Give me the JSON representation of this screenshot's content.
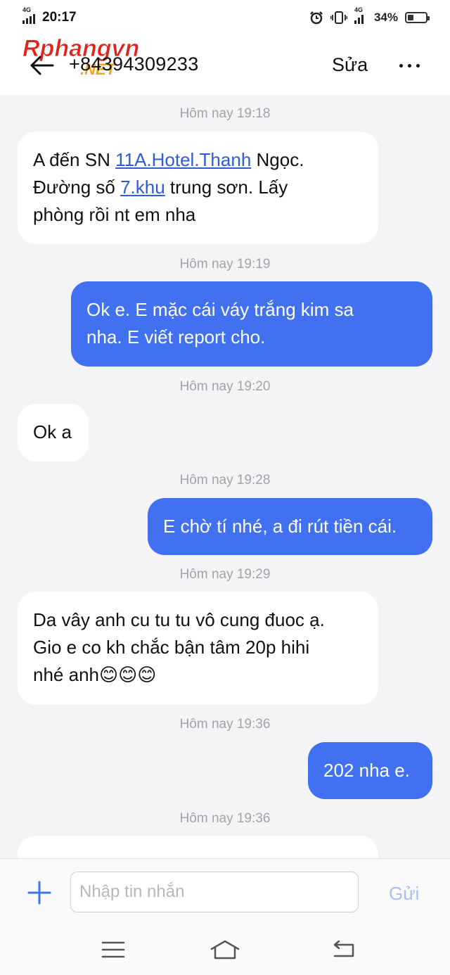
{
  "status_bar": {
    "network_left": "4G",
    "time": "20:17",
    "network_right": "4G",
    "battery_text": "34%",
    "battery_level": 0.34,
    "icons": [
      "signal-icon",
      "alarm-icon",
      "vibrate-icon",
      "battery-icon"
    ]
  },
  "header": {
    "back_icon": "back-arrow-icon",
    "contact": "+84394309233",
    "edit_label": "Sửa",
    "more_icon": "more-dots-icon",
    "watermark": {
      "main": "Rphangvn",
      "sub": ".NET"
    }
  },
  "timestamps": [
    "Hôm nay 19:18",
    "Hôm nay 19:19",
    "Hôm nay 19:20",
    "Hôm nay 19:28",
    "Hôm nay 19:29",
    "Hôm nay 19:36",
    "Hôm nay 19:36"
  ],
  "messages": {
    "m1": {
      "direction": "incoming",
      "l1_a": "A đến SN ",
      "l1_link": "11A.Hotel.Thanh",
      "l1_b": " Ngọc.",
      "l2_a": "Đường số ",
      "l2_link": "7.khu",
      "l2_b": " trung sơn. Lấy",
      "l3": "phòng rồi nt em nha"
    },
    "m2": {
      "direction": "outgoing",
      "l1": "Ok e. E mặc cái váy trắng kim sa",
      "l2": "nha. E viết report cho."
    },
    "m3": {
      "direction": "incoming",
      "l1": "Ok a"
    },
    "m4": {
      "direction": "outgoing",
      "l1": "E chờ tí nhé, a đi rút tiền cái."
    },
    "m5": {
      "direction": "incoming",
      "l1": "Da vây anh cu tu tu vô cung đuoc ạ.",
      "l2": "Gio e co kh chắc bận tâm 20p hihi",
      "l3": "nhé anh😊😊😊"
    },
    "m6": {
      "direction": "outgoing",
      "l1": "202 nha e."
    }
  },
  "input_bar": {
    "plus_icon": "plus-icon",
    "placeholder": "Nhập tin nhắn",
    "value": "",
    "send_label": "Gửi"
  },
  "nav": {
    "menu_icon": "menu-icon",
    "home_icon": "home-icon",
    "back_icon": "back-icon"
  },
  "colors": {
    "outgoing_bubble": "#4170f0",
    "incoming_bubble": "#ffffff",
    "link": "#2e5bd6",
    "send_disabled": "#a8c0ef",
    "background": "#f4f4f6"
  }
}
